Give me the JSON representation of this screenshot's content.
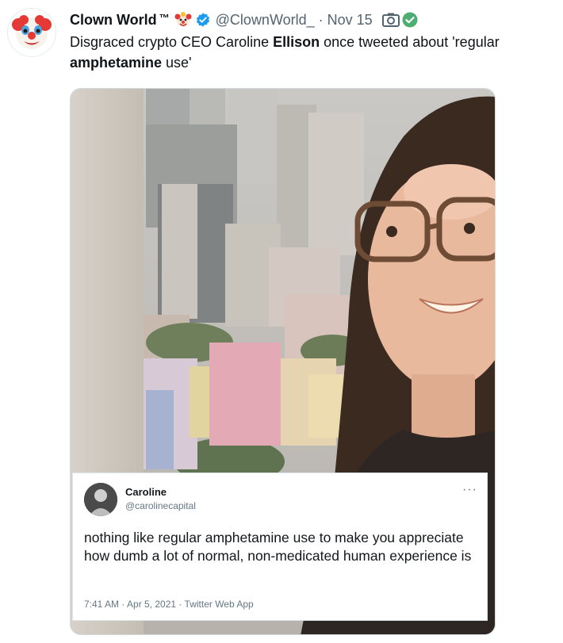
{
  "tweet": {
    "display_name": "Clown World",
    "trademark": "™",
    "handle": "@ClownWorld_",
    "separator": "·",
    "date": "Nov 15",
    "text_parts": [
      "Disgraced crypto CEO Caroline ",
      "Ellison",
      " once tweeted about 'regular ",
      "amphetamine",
      " use'"
    ]
  },
  "embedded_tweet": {
    "name": "Caroline",
    "handle": "@carolinecapital",
    "more": "···",
    "text": "nothing like regular amphetamine use to make you appreciate how dumb a lot of normal, non-medicated human experience is",
    "meta": "7:41 AM · Apr 5, 2021 · Twitter Web App"
  },
  "icons": {
    "avatar": "clown-face-icon",
    "emoji": "clown-emoji-icon",
    "verified": "verified-badge-icon",
    "camera": "camera-icon",
    "status": "check-circle-icon"
  },
  "colors": {
    "verified_blue": "#1d9bf0",
    "status_green": "#4caf72",
    "secondary_text": "#536471"
  }
}
